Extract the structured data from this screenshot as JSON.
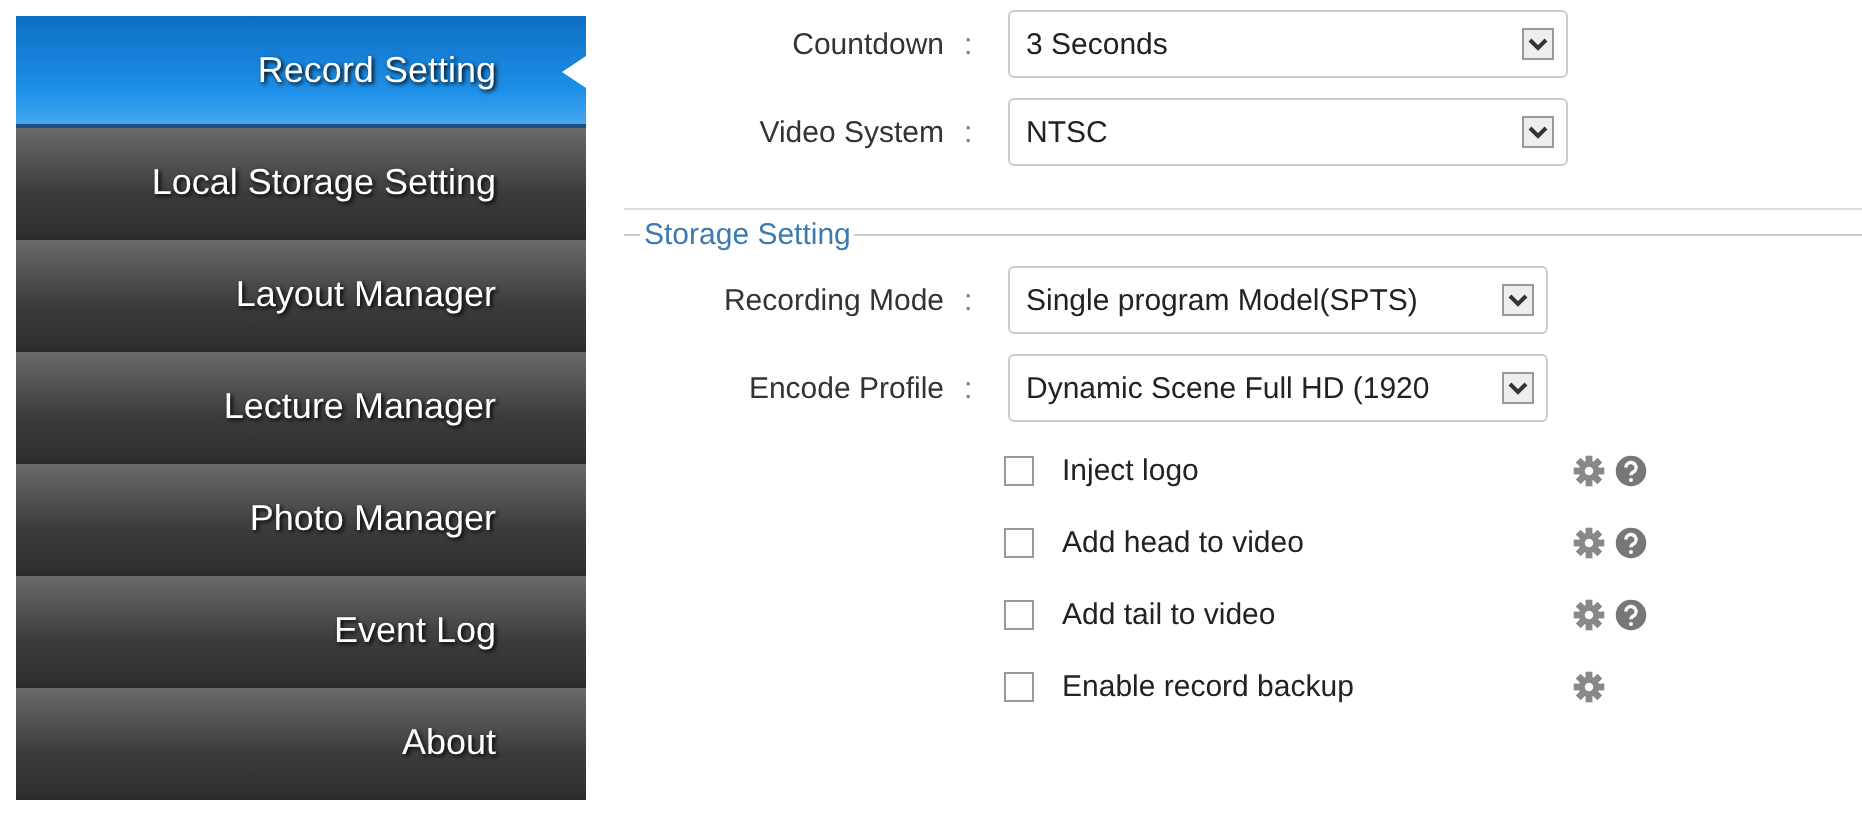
{
  "sidebar": {
    "items": [
      {
        "label": "Record Setting",
        "selected": true
      },
      {
        "label": "Local Storage Setting",
        "selected": false
      },
      {
        "label": "Layout Manager",
        "selected": false
      },
      {
        "label": "Lecture Manager",
        "selected": false
      },
      {
        "label": "Photo Manager",
        "selected": false
      },
      {
        "label": "Event Log",
        "selected": false
      },
      {
        "label": "About",
        "selected": false
      }
    ]
  },
  "record_fields": [
    {
      "label": "Countdown",
      "separator": ":",
      "value": "3 Seconds"
    },
    {
      "label": "Video System",
      "separator": ":",
      "value": "NTSC"
    }
  ],
  "storage_setting": {
    "legend": "Storage Setting",
    "fields": [
      {
        "label": "Recording Mode",
        "separator": ":",
        "value": "Single program Model(SPTS)"
      },
      {
        "label": "Encode Profile",
        "separator": ":",
        "value": "Dynamic Scene Full HD (1920"
      }
    ],
    "options": [
      {
        "label": "Inject logo",
        "checked": false,
        "help": true
      },
      {
        "label": "Add head to video",
        "checked": false,
        "help": true
      },
      {
        "label": "Add tail to video",
        "checked": false,
        "help": true
      },
      {
        "label": "Enable record backup",
        "checked": false,
        "help": false
      }
    ]
  }
}
